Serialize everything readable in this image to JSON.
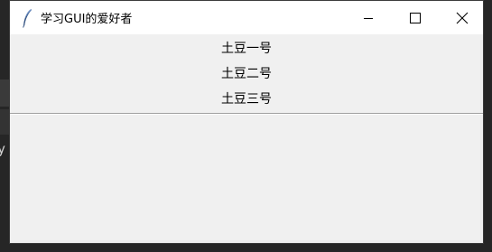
{
  "window": {
    "title": "学习GUI的爱好者",
    "icon": "feather-icon",
    "controls": {
      "minimize": "minimize-icon",
      "maximize": "maximize-icon",
      "close": "close-icon"
    }
  },
  "list": {
    "items": [
      {
        "label": "土豆一号"
      },
      {
        "label": "土豆二号"
      },
      {
        "label": "土豆三号"
      }
    ]
  },
  "background": {
    "editor_char": "y"
  },
  "colors": {
    "titlebar": "#ffffff",
    "window_bg": "#f0f0f0",
    "desktop_bg": "#262626"
  }
}
